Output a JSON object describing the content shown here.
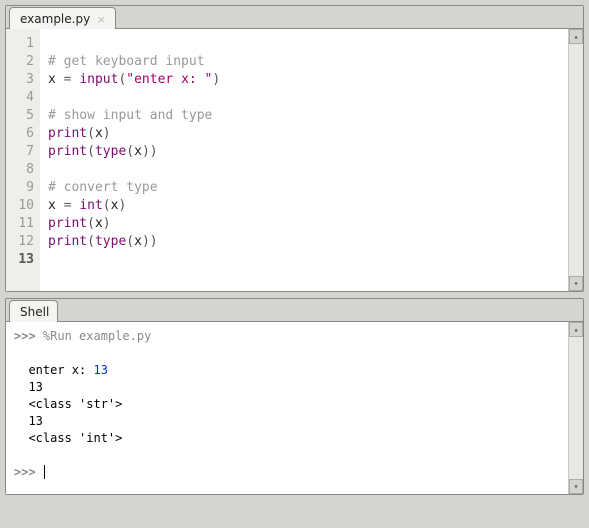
{
  "editor": {
    "tab_label": "example.py",
    "current_line": 13,
    "lines": [
      [],
      [
        {
          "c": "tok-comment",
          "t": "# get keyboard input"
        }
      ],
      [
        {
          "c": "tok-ident",
          "t": "x "
        },
        {
          "c": "tok-op",
          "t": "="
        },
        {
          "c": "tok-ident",
          "t": " "
        },
        {
          "c": "tok-func",
          "t": "input"
        },
        {
          "c": "tok-paren",
          "t": "("
        },
        {
          "c": "tok-str",
          "t": "\"enter x: \""
        },
        {
          "c": "tok-paren",
          "t": ")"
        }
      ],
      [],
      [
        {
          "c": "tok-comment",
          "t": "# show input and type"
        }
      ],
      [
        {
          "c": "tok-func",
          "t": "print"
        },
        {
          "c": "tok-paren",
          "t": "("
        },
        {
          "c": "tok-ident",
          "t": "x"
        },
        {
          "c": "tok-paren",
          "t": ")"
        }
      ],
      [
        {
          "c": "tok-func",
          "t": "print"
        },
        {
          "c": "tok-paren",
          "t": "("
        },
        {
          "c": "tok-func",
          "t": "type"
        },
        {
          "c": "tok-paren",
          "t": "("
        },
        {
          "c": "tok-ident",
          "t": "x"
        },
        {
          "c": "tok-paren",
          "t": "))"
        }
      ],
      [],
      [
        {
          "c": "tok-comment",
          "t": "# convert type"
        }
      ],
      [
        {
          "c": "tok-ident",
          "t": "x "
        },
        {
          "c": "tok-op",
          "t": "="
        },
        {
          "c": "tok-ident",
          "t": " "
        },
        {
          "c": "tok-func",
          "t": "int"
        },
        {
          "c": "tok-paren",
          "t": "("
        },
        {
          "c": "tok-ident",
          "t": "x"
        },
        {
          "c": "tok-paren",
          "t": ")"
        }
      ],
      [
        {
          "c": "tok-func",
          "t": "print"
        },
        {
          "c": "tok-paren",
          "t": "("
        },
        {
          "c": "tok-ident",
          "t": "x"
        },
        {
          "c": "tok-paren",
          "t": ")"
        }
      ],
      [
        {
          "c": "tok-func",
          "t": "print"
        },
        {
          "c": "tok-paren",
          "t": "("
        },
        {
          "c": "tok-func",
          "t": "type"
        },
        {
          "c": "tok-paren",
          "t": "("
        },
        {
          "c": "tok-ident",
          "t": "x"
        },
        {
          "c": "tok-paren",
          "t": "))"
        }
      ],
      []
    ]
  },
  "shell": {
    "tab_label": "Shell",
    "prompt": ">>>",
    "run_cmd": "%Run example.py",
    "output": [
      {
        "prefix": "  ",
        "label": "enter x: ",
        "user": "13"
      },
      {
        "prefix": "  ",
        "text": "13"
      },
      {
        "prefix": "  ",
        "text": "<class 'str'>"
      },
      {
        "prefix": "  ",
        "text": "13"
      },
      {
        "prefix": "  ",
        "text": "<class 'int'>"
      }
    ]
  }
}
